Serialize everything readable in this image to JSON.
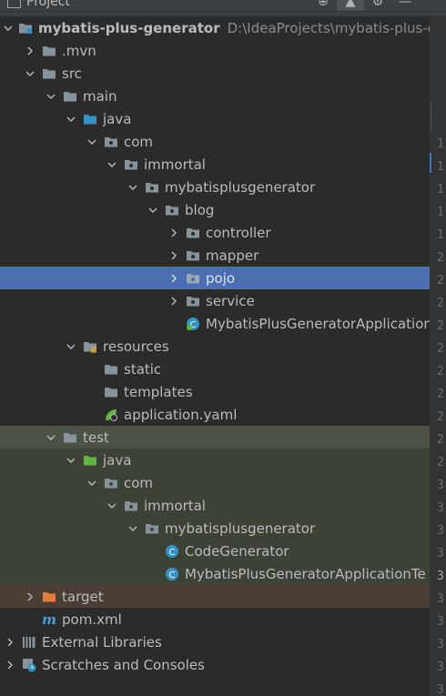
{
  "toolbar": {
    "title": "Project",
    "icons": [
      "add-icon",
      "collapse-icon",
      "settings-icon",
      "minimize-icon"
    ]
  },
  "tree": {
    "root_label": "mybatis-plus-generator",
    "root_path": "D:\\IdeaProjects\\mybatis-plus-ge",
    "items": [
      {
        "label": "mybatis-plus-generator"
      },
      {
        "label": ".mvn"
      },
      {
        "label": "src"
      },
      {
        "label": "main"
      },
      {
        "label": "java"
      },
      {
        "label": "com"
      },
      {
        "label": "immortal"
      },
      {
        "label": "mybatisplusgenerator"
      },
      {
        "label": "blog"
      },
      {
        "label": "controller"
      },
      {
        "label": "mapper"
      },
      {
        "label": "pojo"
      },
      {
        "label": "service"
      },
      {
        "label": "MybatisPlusGeneratorApplication"
      },
      {
        "label": "resources"
      },
      {
        "label": "static"
      },
      {
        "label": "templates"
      },
      {
        "label": "application.yaml"
      },
      {
        "label": "test"
      },
      {
        "label": "java"
      },
      {
        "label": "com"
      },
      {
        "label": "immortal"
      },
      {
        "label": "mybatisplusgenerator"
      },
      {
        "label": "CodeGenerator"
      },
      {
        "label": "MybatisPlusGeneratorApplicationTe"
      },
      {
        "label": "target"
      },
      {
        "label": "pom.xml"
      },
      {
        "label": "External Libraries"
      },
      {
        "label": "Scratches and Consoles"
      }
    ]
  },
  "gutter": {
    "lines": [
      "1",
      "1",
      "1",
      "1",
      "1",
      "2",
      "2",
      "2",
      "2",
      "2",
      "2",
      "2",
      "2",
      "2",
      "2",
      "3",
      "3",
      "3",
      "3",
      "3",
      "3",
      "3",
      "3",
      "3",
      "3"
    ]
  },
  "colors": {
    "selection": "#4b6eaf",
    "folder": "#87939a",
    "source_folder": "#3592c4",
    "test_folder": "#62b543",
    "excluded_folder": "#e57b3d",
    "class_icon": "#3592c4",
    "maven_icon": "#4a9fd8"
  }
}
